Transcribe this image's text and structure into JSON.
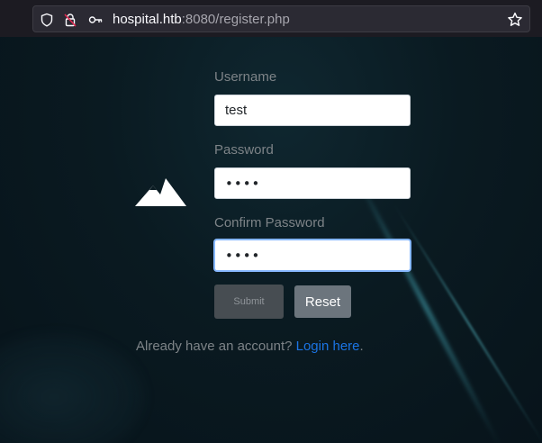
{
  "browser": {
    "url_host": "hospital.htb",
    "url_rest": ":8080/register.php"
  },
  "form": {
    "username_label": "Username",
    "username_value": "test",
    "password_label": "Password",
    "password_value": "••••",
    "confirm_label": "Confirm Password",
    "confirm_value": "••••",
    "submit_label": "Submit",
    "reset_label": "Reset"
  },
  "footer": {
    "prompt": "Already have an account?",
    "link_label": "Login here",
    "suffix": "."
  },
  "colors": {
    "link": "#1b74e4",
    "submit_bg": "#474d52",
    "reset_bg": "#6c757d",
    "focus_border": "#86b7fe"
  },
  "icons": [
    "shield-icon",
    "insecure-lock-icon",
    "key-icon",
    "bookmark-star-icon",
    "mountain-logo-icon"
  ]
}
